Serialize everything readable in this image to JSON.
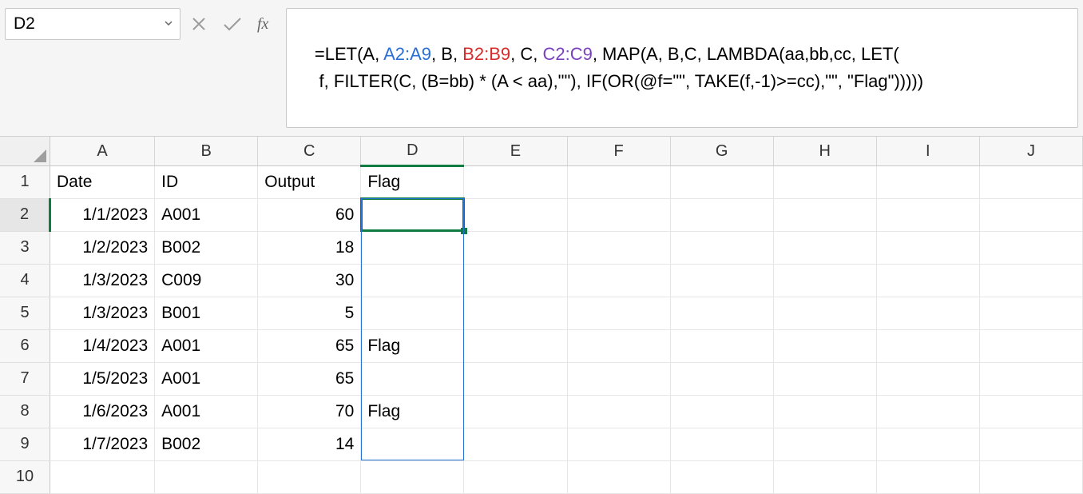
{
  "name_box": "D2",
  "formula": {
    "prefix": "=LET(A, ",
    "range_a": "A2:A9",
    "mid1": ", B, ",
    "range_b": "B2:B9",
    "mid2": ", C, ",
    "range_c": "C2:C9",
    "mid3": ", MAP(A, B,C, LAMBDA(aa,bb,cc, LET(",
    "line2": " f, FILTER(C, (B=bb) * (A < aa),\"\"), IF(OR(@f=\"\", TAKE(f,-1)>=cc),\"\", \"Flag\")))))"
  },
  "columns": [
    "A",
    "B",
    "C",
    "D",
    "E",
    "F",
    "G",
    "H",
    "I",
    "J"
  ],
  "row_numbers": [
    "1",
    "2",
    "3",
    "4",
    "5",
    "6",
    "7",
    "8",
    "9",
    "10"
  ],
  "headers": {
    "A": "Date",
    "B": "ID",
    "C": "Output",
    "D": "Flag"
  },
  "rows": [
    {
      "A": "1/1/2023",
      "B": "A001",
      "C": "60",
      "D": ""
    },
    {
      "A": "1/2/2023",
      "B": "B002",
      "C": "18",
      "D": ""
    },
    {
      "A": "1/3/2023",
      "B": "C009",
      "C": "30",
      "D": ""
    },
    {
      "A": "1/3/2023",
      "B": "B001",
      "C": "5",
      "D": ""
    },
    {
      "A": "1/4/2023",
      "B": "A001",
      "C": "65",
      "D": "Flag"
    },
    {
      "A": "1/5/2023",
      "B": "A001",
      "C": "65",
      "D": ""
    },
    {
      "A": "1/6/2023",
      "B": "A001",
      "C": "70",
      "D": "Flag"
    },
    {
      "A": "1/7/2023",
      "B": "B002",
      "C": "14",
      "D": ""
    }
  ],
  "active_cell": "D2",
  "spill_range": "D2:D9"
}
